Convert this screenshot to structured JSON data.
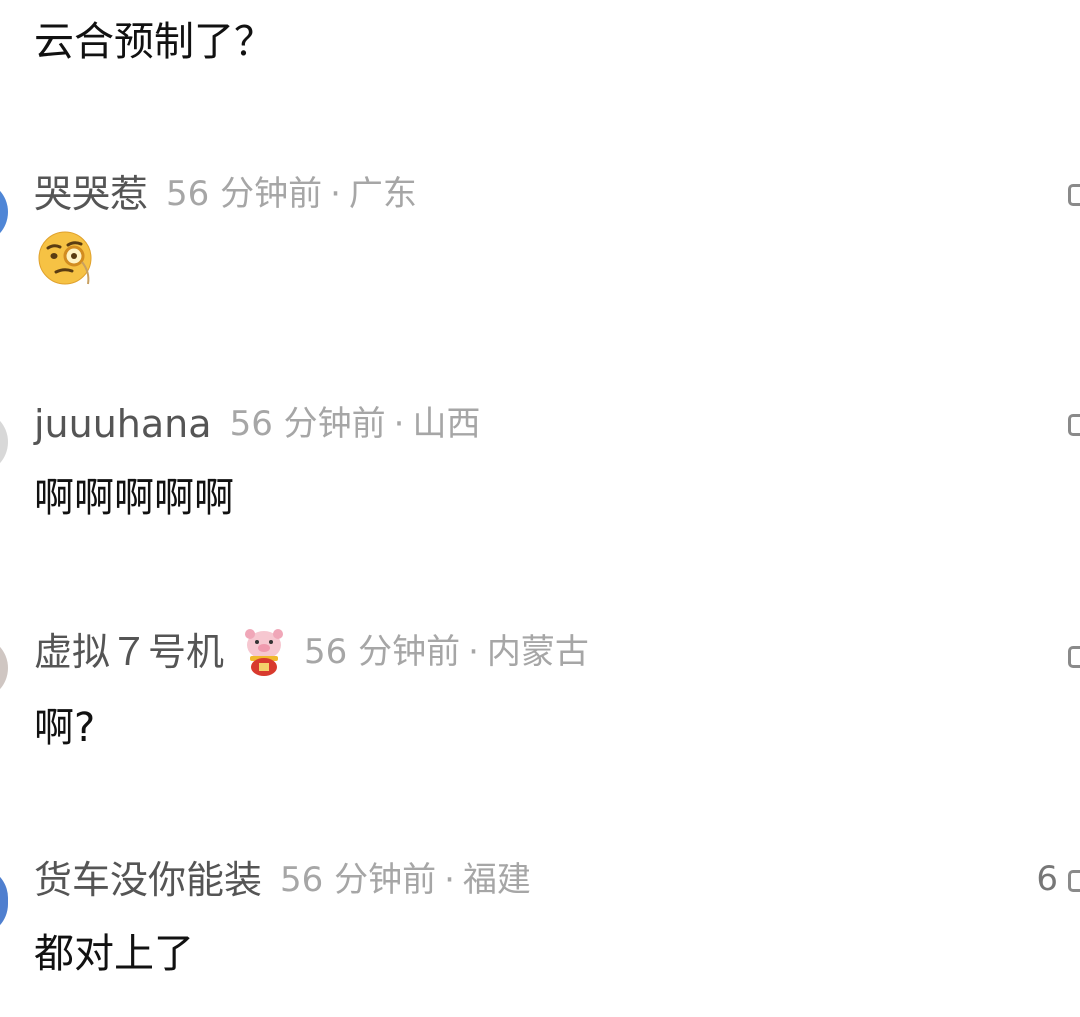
{
  "post": {
    "text": "云合预制了？"
  },
  "comments": [
    {
      "username": "哭哭惹",
      "time": "56 分钟前",
      "separator": "·",
      "location": "广东",
      "content_emoji": "monocle-face-icon",
      "avatar_color": "#4f86d6"
    },
    {
      "username": "juuuhana",
      "time": "56 分钟前",
      "separator": "·",
      "location": "山西",
      "content": "啊啊啊啊啊",
      "avatar_color": "#d8d8d8"
    },
    {
      "username": "虚拟７号机",
      "time": "56 分钟前",
      "separator": "·",
      "location": "内蒙古",
      "content": "啊?",
      "avatar_color": "#cfc6c2",
      "badge_icon": "pig-fortune-badge-icon"
    },
    {
      "username": "货车没你能装",
      "time": "56 分钟前",
      "separator": "·",
      "location": "福建",
      "content": "都对上了",
      "count": "6",
      "avatar_color": "#4f7fcf"
    }
  ],
  "colors": {
    "text_primary": "#111111",
    "username": "#555555",
    "meta": "#a6a6a6",
    "icon": "#8a8a8a"
  }
}
